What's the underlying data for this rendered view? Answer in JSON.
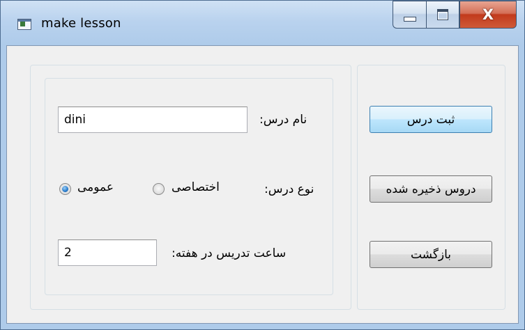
{
  "window": {
    "title": "make lesson",
    "close_glyph": "X",
    "icons": [
      "app-icon",
      "minimize-icon",
      "maximize-icon",
      "close-icon"
    ]
  },
  "form": {
    "lesson_name_label": "نام درس:",
    "lesson_name_value": "dini",
    "lesson_type_label": "نوع درس:",
    "type_options": [
      {
        "label": "اختصاصی",
        "checked": false
      },
      {
        "label": "عمومی",
        "checked": true
      }
    ],
    "weekly_hours_label": "ساعت تدریس در هفته:",
    "weekly_hours_value": "2"
  },
  "buttons": {
    "save_label": "ثبت درس",
    "saved_lessons_label": "دروس ذخیره شده",
    "back_label": "بازگشت"
  },
  "colors": {
    "accent": "#3c7fb1",
    "window_frame": "#aecbea",
    "close_button": "#c23a1c"
  }
}
